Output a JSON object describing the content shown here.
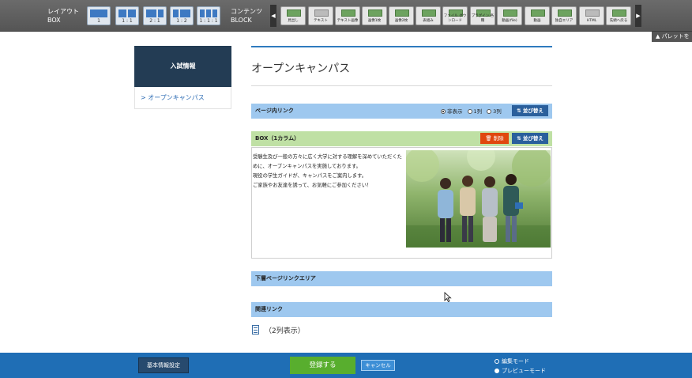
{
  "toolbar": {
    "layout_label": "レイアウト",
    "layout_sub": "BOX",
    "contents_label": "コンテンツ",
    "contents_sub": "BLOCK",
    "layout_buttons": [
      "1",
      "1 : 1",
      "2 : 1",
      "1 : 2",
      "1 : 1 : 1"
    ],
    "block_buttons": [
      "見出し",
      "テキスト",
      "テキスト画像",
      "画像1枚",
      "画像2枚",
      "表組み",
      "ファイル ダウンロード",
      "プラグイン 各種",
      "動画(file)",
      "動画",
      "独自エリア",
      "HTML",
      "先頭へ戻る"
    ],
    "arrow_left": "◀",
    "arrow_right": "▶",
    "palette_button": "▲ パレットを"
  },
  "sidebar": {
    "heading": "入試情報",
    "item": "> オープンキャンパス"
  },
  "main": {
    "title": "オープンキャンパス",
    "page_link_bar": "ページ内リンク",
    "radio_options": [
      "非表示",
      "1列",
      "3列"
    ],
    "sort_label": "⇅ 並び替え",
    "box_title": "BOX（1カラム）",
    "delete_label": "🗑 削除",
    "box_text": "受験生及び一般の方々に広く大学に対する理解を深めていただくために、オープンキャンパスを実施しております。\n現役の学生ガイドが、キャンパスをご案内します。\nご家族やお友達を誘って、お気軽にご参加ください！",
    "lower_links_bar": "下層ページリンクエリア",
    "related_bar": "関連リンク",
    "related_display": "（2列表示）"
  },
  "bottom": {
    "basic_settings": "基本情報設定",
    "save": "登録する",
    "cancel": "キャンセル",
    "mode_edit": "編集モード",
    "mode_preview": "プレビューモード"
  },
  "colors": {
    "toolbar": "#5e5e5e",
    "sidebar_head": "#233c54",
    "bar_blue": "#9ec8ef",
    "box_green": "#bfe0a4",
    "delete_red": "#e0470f",
    "save_green": "#58ae2e",
    "bottom_blue": "#1f6eb5"
  }
}
